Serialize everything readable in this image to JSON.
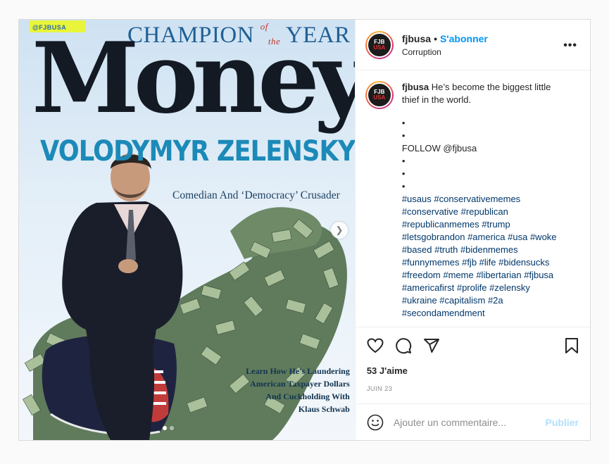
{
  "media": {
    "watermark": "@FJBUSA",
    "magazine_champion": "CHAMPION",
    "magazine_of": "of",
    "magazine_the": "the",
    "magazine_year": "YEAR",
    "magazine_title": "Money",
    "person_name": "VOLODYMYR ZELENSKY",
    "subtitle": "Comedian And ‘Democracy’ Crusader",
    "learn_lines": [
      "Learn How He's Laundering",
      "American Taxpayer Dollars",
      "And Cuckholding With",
      "Klaus Schwab"
    ],
    "next_icon": "chevron-right-icon",
    "carousel_dots": 2,
    "carousel_active": 1
  },
  "header": {
    "avatar_text_top": "FJB",
    "avatar_text_bottom": "USA",
    "username": "fjbusa",
    "separator": "•",
    "follow_label": "S'abonner",
    "location": "Corruption",
    "more_label": "•••"
  },
  "caption": {
    "username": "fjbusa",
    "text": "He’s become the biggest little thief in the world.",
    "lines": [
      "•",
      "•",
      "FOLLOW @fjbusa",
      "•",
      "•",
      "•"
    ],
    "hashtags": "#usaus #conservativememes #conservative #republican #republicanmemes #trump #letsgobrandon #america #usa #woke #based #truth #bidenmemes #funnymemes #fjb #life #bidensucks #freedom #meme #libertarian #fjbusa #americafirst #prolife #zelensky #ukraine #capitalism #2a #secondamendment"
  },
  "actions": {
    "like_icon": "heart-icon",
    "comment_icon": "comment-icon",
    "share_icon": "share-icon",
    "save_icon": "bookmark-icon"
  },
  "likes": "53 J'aime",
  "date": "JUIN 23",
  "comment": {
    "emoji_icon": "emoji-icon",
    "placeholder": "Ajouter un commentaire...",
    "publish_label": "Publier"
  },
  "colors": {
    "accent": "#0095f6",
    "hashtag": "#00376b",
    "publish_disabled": "#b2dffc"
  }
}
